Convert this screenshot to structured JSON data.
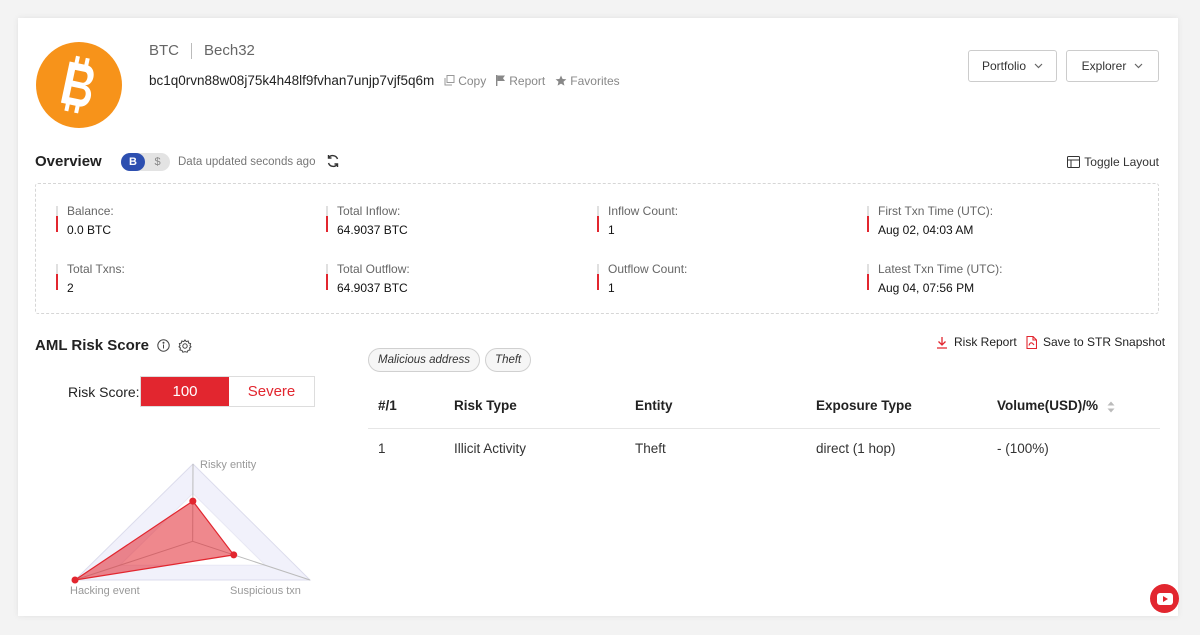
{
  "header": {
    "coin": "BTC",
    "format": "Bech32",
    "address": "bc1q0rvn88w08j75k4h48lf9fvhan7unjp7vjf5q6m",
    "actions": {
      "copy": "Copy",
      "report": "Report",
      "favorites": "Favorites"
    },
    "buttons": {
      "portfolio": "Portfolio",
      "explorer": "Explorer"
    }
  },
  "overview": {
    "title": "Overview",
    "currency_options": [
      "B",
      "$"
    ],
    "selected_currency": "B",
    "updated": "Data updated seconds ago",
    "toggle_layout": "Toggle Layout",
    "stats": [
      {
        "label": "Balance:",
        "value": "0.0 BTC"
      },
      {
        "label": "Total Inflow:",
        "value": "64.9037 BTC"
      },
      {
        "label": "Inflow Count:",
        "value": "1"
      },
      {
        "label": "First Txn Time (UTC):",
        "value": "Aug 02, 04:03 AM"
      },
      {
        "label": "Total Txns:",
        "value": "2"
      },
      {
        "label": "Total Outflow:",
        "value": "64.9037 BTC"
      },
      {
        "label": "Outflow Count:",
        "value": "1"
      },
      {
        "label": "Latest Txn Time (UTC):",
        "value": "Aug 04, 07:56 PM"
      }
    ]
  },
  "aml": {
    "title": "AML Risk Score",
    "risk_label": "Risk Score:",
    "score": "100",
    "level": "Severe",
    "radar_labels": {
      "top": "Risky entity",
      "left": "Hacking event",
      "right": "Suspicious txn"
    },
    "radar_levels": {
      "risky_entity": 0.52,
      "hacking_event": 1.0,
      "suspicious_txn": 0.35
    },
    "tags": [
      "Malicious address",
      "Theft"
    ],
    "actions": {
      "risk_report": "Risk Report",
      "save": "Save to STR Snapshot"
    },
    "table": {
      "headers": [
        "#/1",
        "Risk Type",
        "Entity",
        "Exposure Type",
        "Volume(USD)/%"
      ],
      "rows": [
        [
          "1",
          "Illicit Activity",
          "Theft",
          "direct (1 hop)",
          "- (100%)"
        ]
      ]
    }
  },
  "colors": {
    "accent": "#e2262f",
    "bitcoin": "#f7931a",
    "toggle": "#2d4fb0"
  }
}
